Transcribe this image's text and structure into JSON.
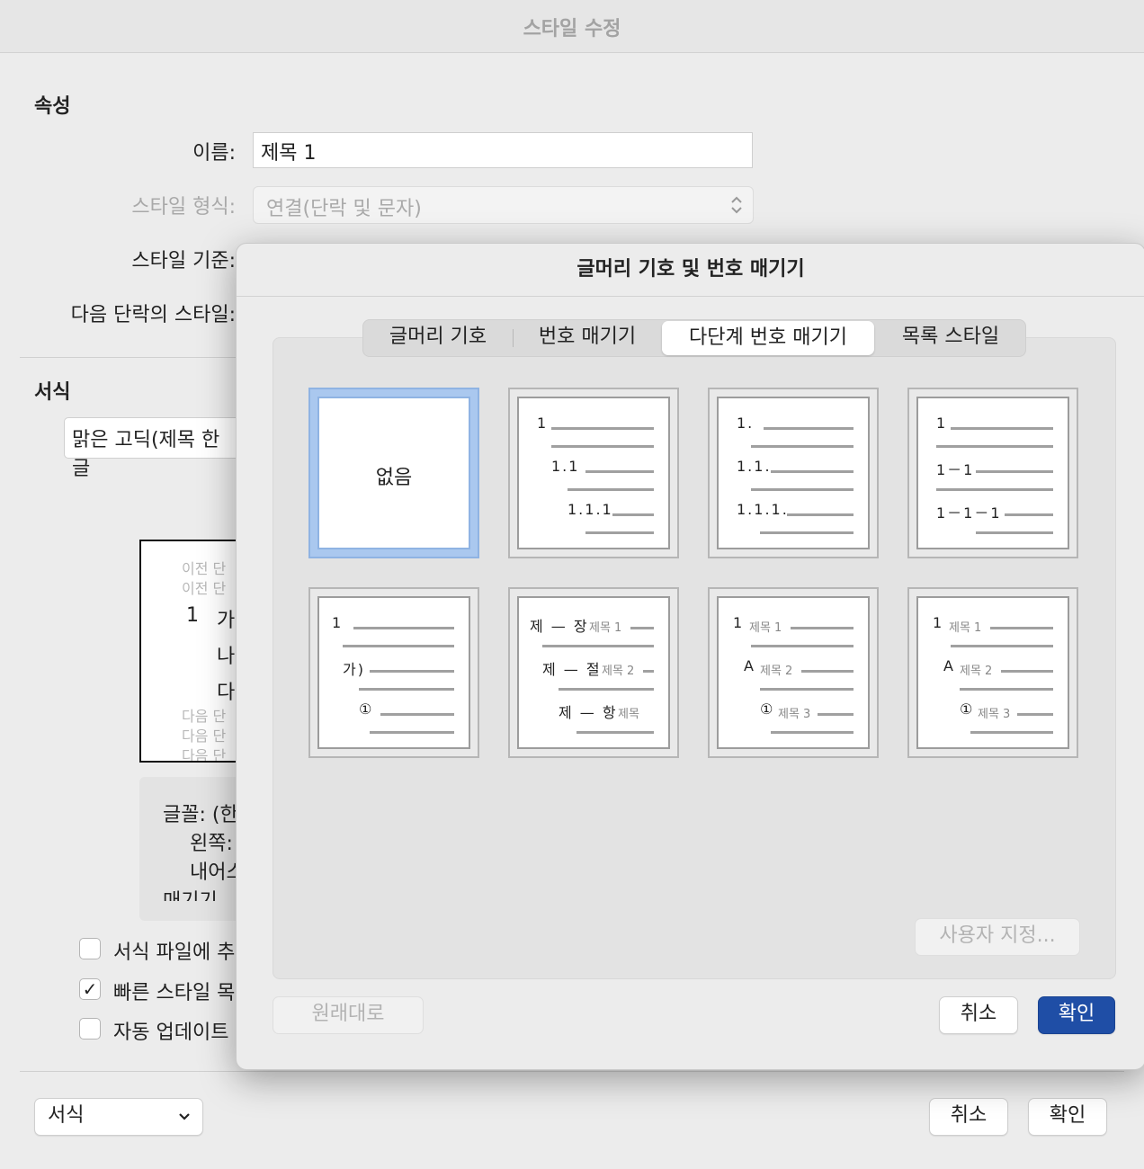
{
  "back_window": {
    "title": "스타일 수정",
    "properties_header": "속성",
    "name_label": "이름:",
    "name_value": "제목 1",
    "style_type_label": "스타일 형식:",
    "style_type_value": "연결(단락 및 문자)",
    "style_based_label": "스타일 기준:",
    "next_para_label": "다음 단락의 스타일:",
    "format_header": "서식",
    "font_value": "맑은 고딕(제목 한글",
    "preview": {
      "prev1": "이전 단",
      "prev2": "이전 단",
      "num": "1",
      "line1": "가",
      "line2": "나",
      "line3": "다",
      "next1": "다음 단",
      "next2": "다음 단",
      "next3": "다음 단"
    },
    "desc": {
      "l1": "글꼴: (한",
      "l2": "왼쪽:",
      "l3": "내어스",
      "l4": "매기기 ..."
    },
    "checks": [
      {
        "label": "서식 파일에 추",
        "checked": false
      },
      {
        "label": "빠른 스타일 목",
        "checked": true
      },
      {
        "label": "자동 업데이트",
        "checked": false
      }
    ],
    "format_menu": "서식",
    "cancel": "취소",
    "ok": "확인"
  },
  "dialog": {
    "title": "글머리 기호 및 번호 매기기",
    "tabs": [
      "글머리 기호",
      "번호 매기기",
      "다단계 번호 매기기",
      "목록 스타일"
    ],
    "active_tab": 2,
    "none_label": "없음",
    "presets": {
      "p2": [
        "1",
        "1.1",
        "1.1.1"
      ],
      "p3": [
        "1.",
        "1.1.",
        "1.1.1."
      ],
      "p4": [
        "1",
        "1－1",
        "1－1－1"
      ],
      "p5": [
        "1",
        "가)",
        "①"
      ],
      "p6": [
        {
          "main": "제 — 장",
          "sub": "제목 1"
        },
        {
          "main": "제 — 절",
          "sub": "제목 2"
        },
        {
          "main": "제 — 항",
          "sub": "제목"
        }
      ],
      "p7": [
        {
          "main": "1",
          "sub": "제목 1"
        },
        {
          "main": "A",
          "sub": "제목 2"
        },
        {
          "main": "①",
          "sub": "제목 3"
        }
      ],
      "p8": [
        {
          "main": "1",
          "sub": "제목 1"
        },
        {
          "main": "A",
          "sub": "제목 2"
        },
        {
          "main": "①",
          "sub": "제목 3"
        }
      ]
    },
    "customize": "사용자 지정...",
    "reset": "원래대로",
    "cancel": "취소",
    "ok": "확인"
  }
}
